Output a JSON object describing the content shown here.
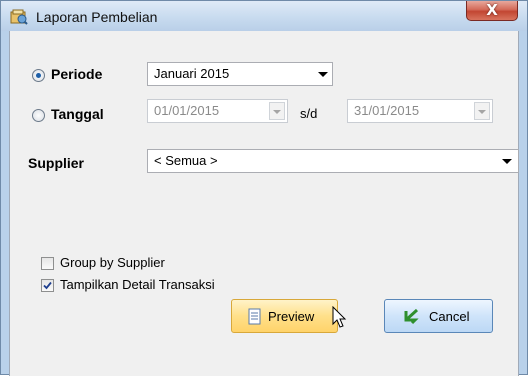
{
  "window": {
    "title": "Laporan Pembelian",
    "close_symbol": "X"
  },
  "periode": {
    "label": "Periode",
    "selected": true,
    "value": "Januari 2015"
  },
  "tanggal": {
    "label": "Tanggal",
    "selected": false,
    "from": "01/01/2015",
    "separator": "s/d",
    "to": "31/01/2015"
  },
  "supplier": {
    "label": "Supplier",
    "value": "< Semua >"
  },
  "options": [
    {
      "label": "Group by Supplier",
      "checked": false
    },
    {
      "label": "Tampilkan Detail Transaksi",
      "checked": true
    }
  ],
  "buttons": {
    "preview": "Preview",
    "cancel": "Cancel"
  },
  "colors": {
    "accent_radio": "#1d5fa8",
    "preview_bg": "#ffe08a",
    "cancel_bg": "#cfe4fa",
    "close_bg": "#c24632"
  }
}
